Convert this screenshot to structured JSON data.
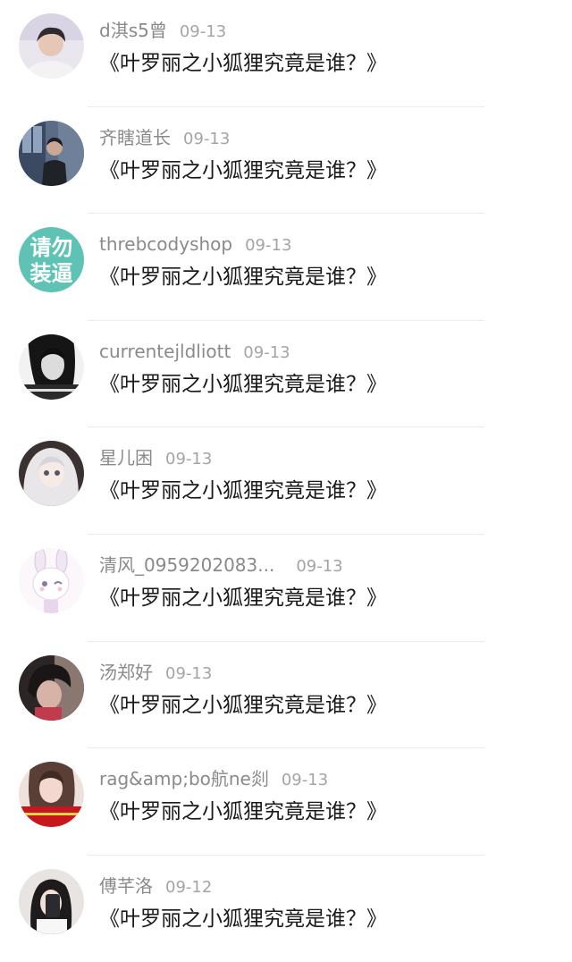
{
  "comments": [
    {
      "user": "d淇s5曾",
      "time": "09-13",
      "title": "《叶罗丽之小狐狸究竟是谁？》",
      "avatar": "portrait-boy-avatar"
    },
    {
      "user": "齐瞎道长",
      "time": "09-13",
      "title": "《叶罗丽之小狐狸究竟是谁？》",
      "avatar": "window-portrait-avatar"
    },
    {
      "user": "threbcodyshop",
      "time": "09-13",
      "title": "《叶罗丽之小狐狸究竟是谁？》",
      "avatar": "text-avatar",
      "avatar_text": [
        "请勿",
        "装逼"
      ],
      "avatar_color": "#5ec3b4"
    },
    {
      "user": "currentejldliott",
      "time": "09-13",
      "title": "《叶罗丽之小狐狸究竟是谁？》",
      "avatar": "bw-portrait-avatar"
    },
    {
      "user": "星儿困",
      "time": "09-13",
      "title": "《叶罗丽之小狐狸究竟是谁？》",
      "avatar": "anime-girl-avatar"
    },
    {
      "user": "清风_0959202083...",
      "time": "09-13",
      "title": "《叶罗丽之小狐狸究竟是谁？》",
      "avatar": "cartoon-bunny-avatar"
    },
    {
      "user": "汤郑好",
      "time": "09-13",
      "title": "《叶罗丽之小狐狸究竟是谁？》",
      "avatar": "dark-portrait-avatar"
    },
    {
      "user": "rag&amp;bo航ne剡",
      "time": "09-13",
      "title": "《叶罗丽之小狐狸究竟是谁？》",
      "avatar": "red-banner-portrait-avatar"
    },
    {
      "user": "傅芊洛",
      "time": "09-12",
      "title": "《叶罗丽之小狐狸究竟是谁？》",
      "avatar": "phone-selfie-avatar"
    }
  ]
}
